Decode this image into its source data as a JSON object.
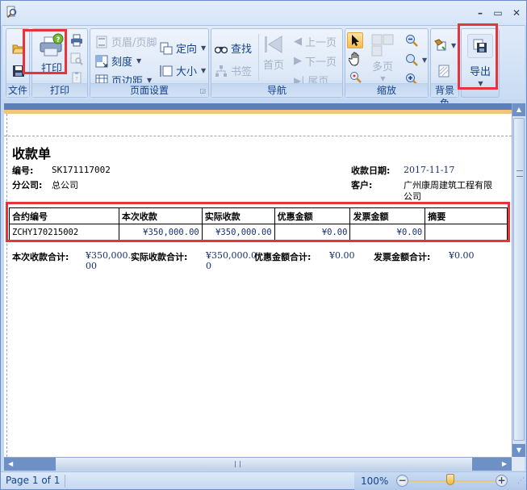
{
  "ribbon": {
    "groups": {
      "file": "文件",
      "print": "打印",
      "page_setup": "页面设置",
      "navigation": "导航",
      "zoom": "缩放",
      "background": "背景色"
    },
    "print_button": "打印",
    "header_footer": "页眉/页脚",
    "scale": "刻度",
    "margins": "页边距",
    "orientation": "定向",
    "size": "大小",
    "find": "查找",
    "bookmark": "书签",
    "first_page": "首页",
    "prev_page": "上一页",
    "next_page": "下一页",
    "last_page": "尾页",
    "multi_page": "多页",
    "export": "导出"
  },
  "document": {
    "title": "收款单",
    "fields": {
      "number_label": "编号:",
      "number_value": "SK171117002",
      "branch_label": "分公司:",
      "branch_value": "总公司",
      "date_label": "收款日期:",
      "date_value": "2017-11-17",
      "customer_label": "客户:",
      "customer_value_line1": "广州康周建筑工程有限",
      "customer_value_line2": "公司"
    },
    "table": {
      "headers": [
        "合约编号",
        "本次收款",
        "实际收款",
        "优惠金额",
        "发票金额",
        "摘要"
      ],
      "rows": [
        [
          "ZCHY170215002",
          "¥350,000.00",
          "¥350,000.00",
          "¥0.00",
          "¥0.00",
          ""
        ]
      ]
    },
    "summary": {
      "current_label": "本次收款合计:",
      "current_value_line1": "¥350,000.",
      "current_value_line2": "00",
      "actual_label": "实际收款合计:",
      "actual_value_line1": "¥350,000.0",
      "actual_value_line2": "0",
      "discount_label": "优惠金额合计:",
      "discount_value": "¥0.00",
      "invoice_label": "发票金额合计:",
      "invoice_value": "¥0.00"
    }
  },
  "status": {
    "page": "Page 1 of 1",
    "zoom": "100%"
  }
}
